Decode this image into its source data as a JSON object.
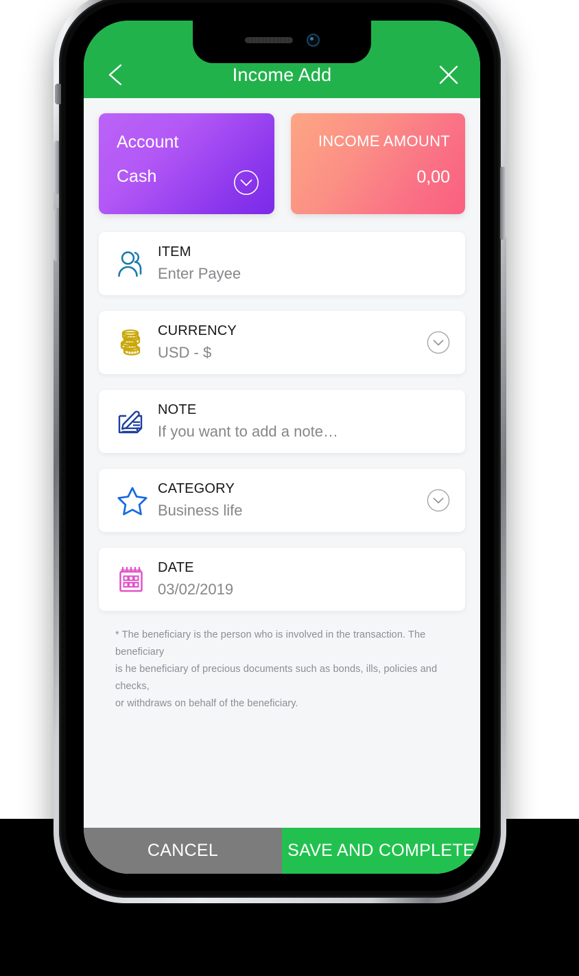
{
  "header": {
    "title": "Income Add",
    "back_icon": "chevron-left-icon",
    "close_icon": "close-icon",
    "bg_color": "#22b24c"
  },
  "cards": {
    "account": {
      "label": "Account",
      "value": "Cash",
      "chevron_icon": "chevron-down-circle-icon",
      "gradient_from": "#bb63f7",
      "gradient_to": "#7c2ae8"
    },
    "amount": {
      "label": "INCOME AMOUNT",
      "value": "0,00",
      "gradient_from": "#fda684",
      "gradient_to": "#fa5f7f"
    }
  },
  "fields": [
    {
      "label": "ITEM",
      "value": "Enter Payee",
      "icon": "people-icon",
      "icon_color": "#1a7bab",
      "has_chevron": false
    },
    {
      "label": "CURRENCY",
      "value": "USD - $",
      "icon": "coins-icon",
      "icon_color": "#c9a708",
      "has_chevron": true
    },
    {
      "label": "NOTE",
      "value": "If you want to add a note…",
      "icon": "note-pencil-icon",
      "icon_color": "#1d3f9e",
      "has_chevron": false
    },
    {
      "label": "CATEGORY",
      "value": "Business life",
      "icon": "star-icon",
      "icon_color": "#1569e0",
      "has_chevron": true
    },
    {
      "label": "DATE",
      "value": "03/02/2019",
      "icon": "calendar-icon",
      "icon_color": "#e152c8",
      "has_chevron": false
    }
  ],
  "footnote": {
    "line1": "* The beneficiary is the person who is involved in the transaction. The beneficiary",
    "line2": " is he beneficiary of precious documents such as bonds, ills, policies and checks,",
    "line3": "or withdraws on behalf of the beneficiary."
  },
  "actions": {
    "cancel_label": "CANCEL",
    "save_label": "SAVE AND COMPLETE",
    "cancel_color": "#7c7c7c",
    "save_color": "#22c14f"
  },
  "device": {
    "speaker_icon": "speaker-grille-icon",
    "camera_icon": "front-camera-icon"
  }
}
